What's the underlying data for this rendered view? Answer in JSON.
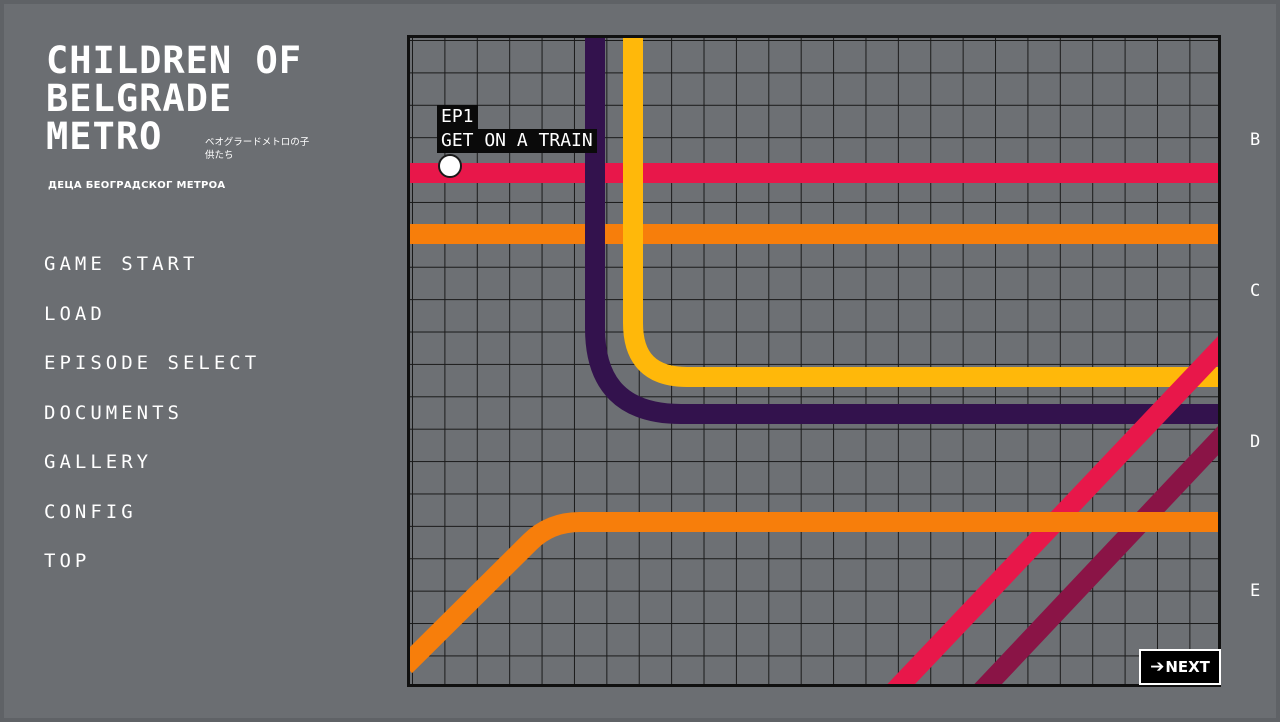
{
  "game": {
    "title_lines": [
      "CHILDREN OF",
      "BELGRADE",
      "METRO"
    ],
    "subtitle_jp": "ベオグラードメトロの子供たち",
    "subtitle_sr": "ДЕЦА БЕОГРАДСКОГ МЕТРОА"
  },
  "menu": {
    "items": [
      {
        "label": "GAME START"
      },
      {
        "label": "LOAD"
      },
      {
        "label": "EPISODE SELECT"
      },
      {
        "label": "DOCUMENTS"
      },
      {
        "label": "GALLERY"
      },
      {
        "label": "CONFIG"
      },
      {
        "label": "TOP"
      }
    ]
  },
  "map": {
    "episode": {
      "number": "EP1",
      "title": "GET ON A TRAIN"
    },
    "side_letters": [
      "B",
      "C",
      "D",
      "E"
    ],
    "line_colors": {
      "red": "#e8174a",
      "orange": "#f77e0b",
      "yellow": "#ffb80a",
      "purple": "#33124d",
      "maroon": "#8a1446"
    }
  },
  "next_button": {
    "arrow": "➔",
    "label": "NEXT"
  }
}
